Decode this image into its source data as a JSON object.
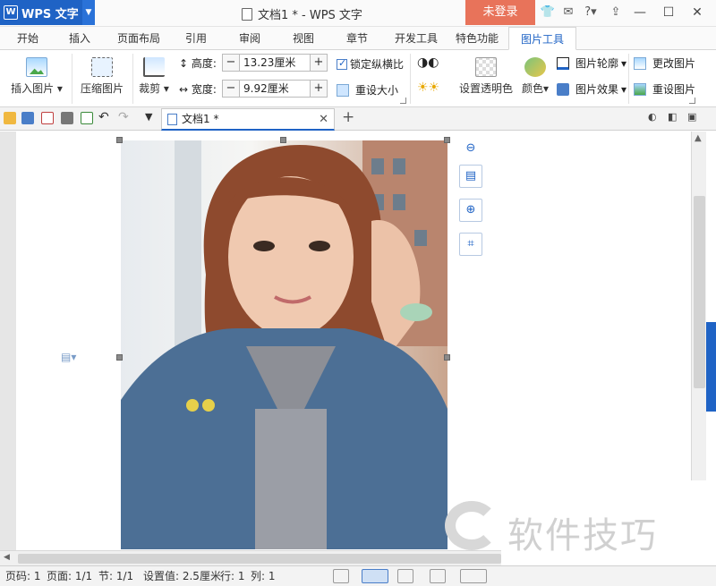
{
  "titlebar": {
    "app_name": "WPS 文字",
    "logo_letter": "W",
    "doc_title": "文档1 * - WPS 文字",
    "login_label": "未登录"
  },
  "tabs": [
    "开始",
    "插入",
    "页面布局",
    "引用",
    "审阅",
    "视图",
    "章节",
    "开发工具",
    "特色功能",
    "图片工具"
  ],
  "active_tab": "图片工具",
  "ribbon": {
    "insert_picture": "插入图片",
    "compress_picture": "压缩图片",
    "crop": "裁剪",
    "height_label": "高度:",
    "height_value": "13.23厘米",
    "width_label": "宽度:",
    "width_value": "9.92厘米",
    "lock_ratio": "锁定纵横比",
    "reset_size": "重设大小",
    "set_transparent": "设置透明色",
    "color": "颜色",
    "outline": "图片轮廓",
    "effect": "图片效果",
    "change_picture": "更改图片",
    "reset_picture": "重设图片"
  },
  "doc_tab": {
    "label": "文档1 *"
  },
  "status": {
    "page_no": "页码: 1",
    "pages": "页面: 1/1",
    "section": "节: 1/1",
    "setting": "设置值: 2.5厘米",
    "row": "行: 1",
    "col": "列: 1"
  },
  "watermark": "软件技巧",
  "colors": {
    "brand": "#1f63c5",
    "login": "#e8735a"
  }
}
